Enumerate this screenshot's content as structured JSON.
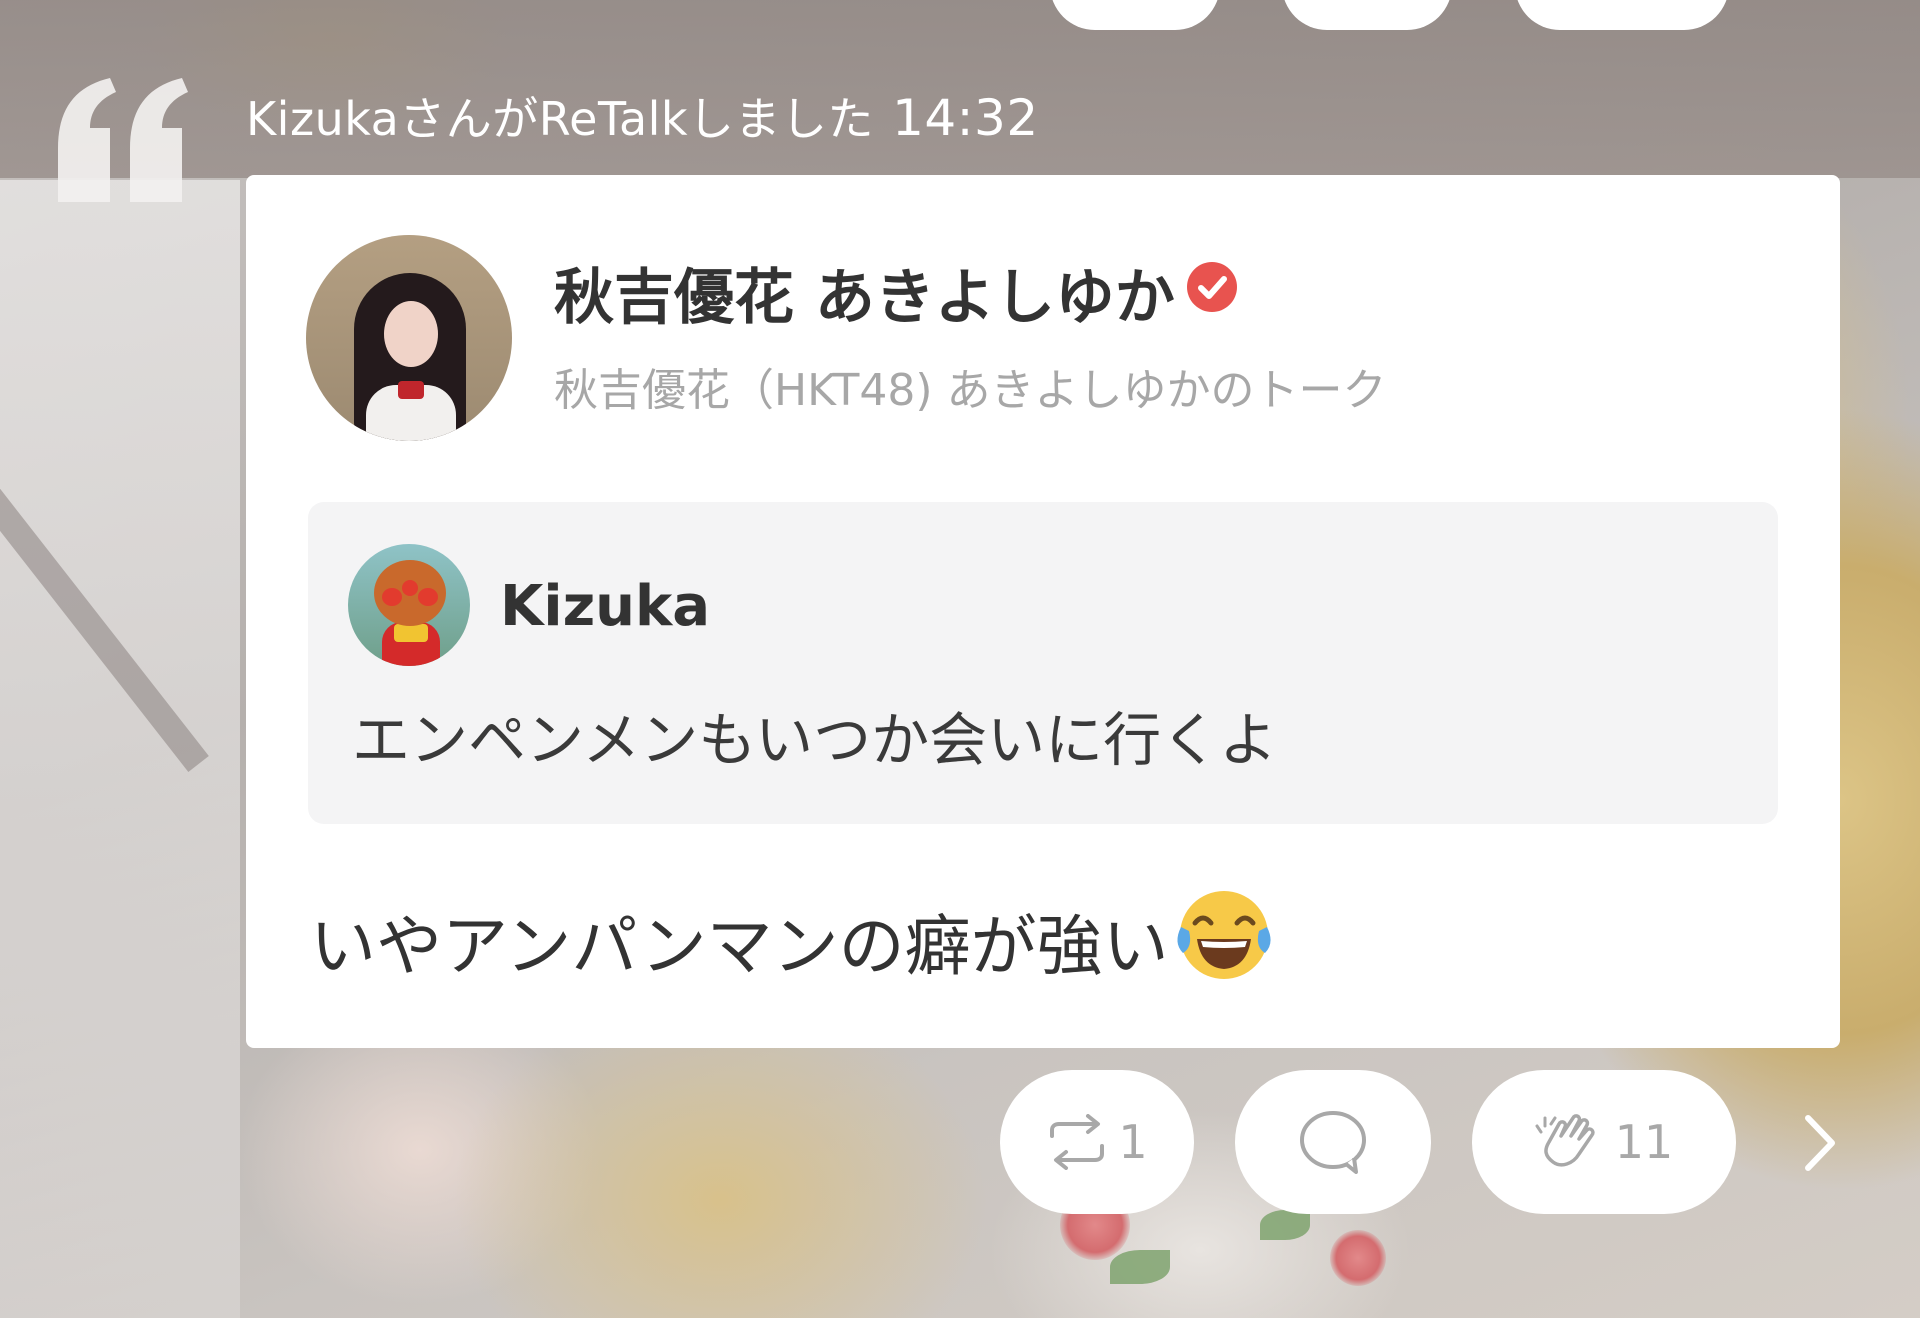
{
  "header": {
    "retalk_notice": "KizukaさんがReTalkしました",
    "time": "14:32"
  },
  "card": {
    "author_name": "秋吉優花 あきよしゆか",
    "author_subtitle": "秋吉優花（HKT48) あきよしゆかのトーク",
    "quoted": {
      "author_name": "Kizuka",
      "text": "エンペンメンもいつか会いに行くよ"
    },
    "text": "いやアンパンマンの癖が強い"
  },
  "actions": {
    "retalk_count": "1",
    "clap_count": "11"
  },
  "colors": {
    "verified_badge": "#e8534f",
    "card_bg": "#ffffff",
    "quoted_bg": "#f4f4f5",
    "muted_text": "#a7a7a7"
  },
  "icons": [
    "quote-mark-icon",
    "verified-badge-icon",
    "retalk-icon",
    "comment-icon",
    "clap-icon",
    "chevron-right-icon",
    "laughing-emoji-icon"
  ]
}
